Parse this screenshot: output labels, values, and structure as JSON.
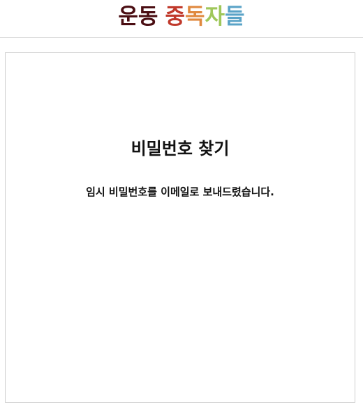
{
  "header": {
    "logo": [
      {
        "text": "운동",
        "color": "#4a0d12"
      },
      {
        "text": "중",
        "color": "#c0392b"
      },
      {
        "text": "독",
        "color": "#e0893f"
      },
      {
        "text": "자",
        "color": "#9fc75a"
      },
      {
        "text": "들",
        "color": "#5aa3c7"
      }
    ]
  },
  "card": {
    "title": "비밀번호 찾기",
    "message": "임시 비밀번호를 이메일로 보내드렸습니다."
  }
}
